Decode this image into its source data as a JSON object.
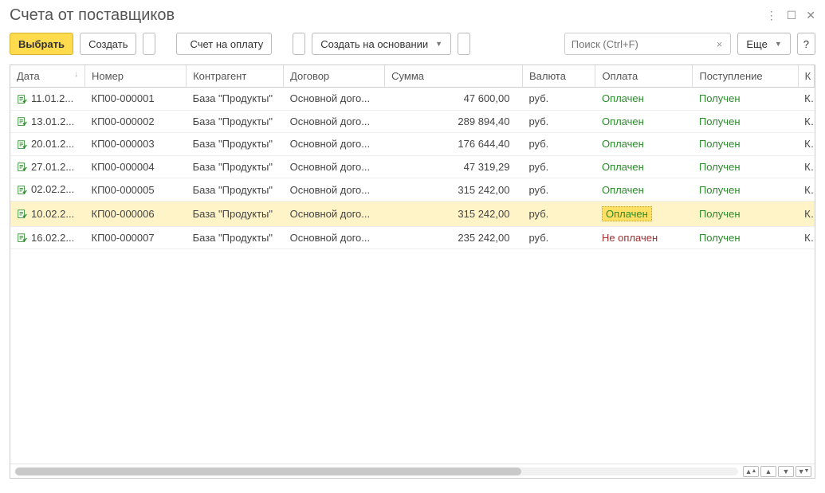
{
  "title": "Счета от поставщиков",
  "toolbar": {
    "select": "Выбрать",
    "create": "Создать",
    "invoice": "Счет на оплату",
    "create_based": "Создать на основании",
    "more": "Еще"
  },
  "search": {
    "placeholder": "Поиск (Ctrl+F)"
  },
  "columns": {
    "date": "Дата",
    "number": "Номер",
    "counterparty": "Контрагент",
    "contract": "Договор",
    "sum": "Сумма",
    "currency": "Валюта",
    "payment": "Оплата",
    "receipt": "Поступление",
    "extra": "К"
  },
  "rows": [
    {
      "date": "11.01.2...",
      "number": "КП00-000001",
      "counterparty": "База \"Продукты\"",
      "contract": "Основной дого...",
      "sum": "47 600,00",
      "currency": "руб.",
      "payment": "Оплачен",
      "payment_status": "paid",
      "receipt": "Получен",
      "extra": "К"
    },
    {
      "date": "13.01.2...",
      "number": "КП00-000002",
      "counterparty": "База \"Продукты\"",
      "contract": "Основной дого...",
      "sum": "289 894,40",
      "currency": "руб.",
      "payment": "Оплачен",
      "payment_status": "paid",
      "receipt": "Получен",
      "extra": "К"
    },
    {
      "date": "20.01.2...",
      "number": "КП00-000003",
      "counterparty": "База \"Продукты\"",
      "contract": "Основной дого...",
      "sum": "176 644,40",
      "currency": "руб.",
      "payment": "Оплачен",
      "payment_status": "paid",
      "receipt": "Получен",
      "extra": "К"
    },
    {
      "date": "27.01.2...",
      "number": "КП00-000004",
      "counterparty": "База \"Продукты\"",
      "contract": "Основной дого...",
      "sum": "47 319,29",
      "currency": "руб.",
      "payment": "Оплачен",
      "payment_status": "paid",
      "receipt": "Получен",
      "extra": "К"
    },
    {
      "date": "02.02.2...",
      "number": "КП00-000005",
      "counterparty": "База \"Продукты\"",
      "contract": "Основной дого...",
      "sum": "315 242,00",
      "currency": "руб.",
      "payment": "Оплачен",
      "payment_status": "paid",
      "receipt": "Получен",
      "extra": "К"
    },
    {
      "date": "10.02.2...",
      "number": "КП00-000006",
      "counterparty": "База \"Продукты\"",
      "contract": "Основной дого...",
      "sum": "315 242,00",
      "currency": "руб.",
      "payment": "Оплачен",
      "payment_status": "paid",
      "receipt": "Получен",
      "extra": "К",
      "selected": true
    },
    {
      "date": "16.02.2...",
      "number": "КП00-000007",
      "counterparty": "База \"Продукты\"",
      "contract": "Основной дого...",
      "sum": "235 242,00",
      "currency": "руб.",
      "payment": "Не оплачен",
      "payment_status": "unpaid",
      "receipt": "Получен",
      "extra": "К"
    }
  ]
}
